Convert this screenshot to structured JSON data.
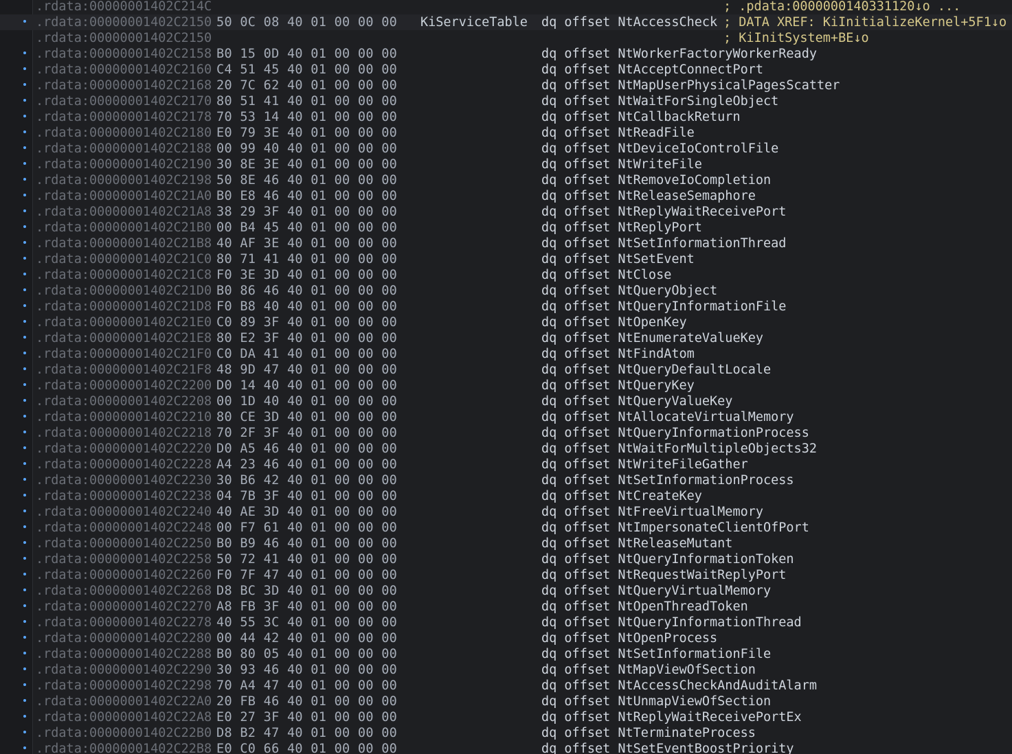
{
  "colors": {
    "background": "#1e1f22",
    "address": "#6b6f77",
    "bytes": "#a6adb8",
    "code": "#d0d6de",
    "comment": "#d7c98a",
    "breakpoint_dot": "#5aa7ff"
  },
  "rows": [
    {
      "addr": ".rdata:00000001402C214C",
      "bytes": "",
      "label": "",
      "instr": "",
      "comment": "; .pdata:0000000140331120↓o ...",
      "dot": false
    },
    {
      "addr": ".rdata:00000001402C2150",
      "bytes": "50 0C 08 40 01 00 00 00",
      "label": "KiServiceTable",
      "instr": "dq offset NtAccessCheck",
      "comment": "; DATA XREF: KiInitializeKernel+5F1↓o",
      "dot": true
    },
    {
      "addr": ".rdata:00000001402C2150",
      "bytes": "",
      "label": "",
      "instr": "",
      "comment": "; KiInitSystem+BE↓o",
      "dot": false
    },
    {
      "addr": ".rdata:00000001402C2158",
      "bytes": "B0 15 0D 40 01 00 00 00",
      "label": "",
      "instr": "dq offset NtWorkerFactoryWorkerReady",
      "comment": "",
      "dot": true
    },
    {
      "addr": ".rdata:00000001402C2160",
      "bytes": "C4 51 45 40 01 00 00 00",
      "label": "",
      "instr": "dq offset NtAcceptConnectPort",
      "comment": "",
      "dot": true
    },
    {
      "addr": ".rdata:00000001402C2168",
      "bytes": "20 7C 62 40 01 00 00 00",
      "label": "",
      "instr": "dq offset NtMapUserPhysicalPagesScatter",
      "comment": "",
      "dot": true
    },
    {
      "addr": ".rdata:00000001402C2170",
      "bytes": "80 51 41 40 01 00 00 00",
      "label": "",
      "instr": "dq offset NtWaitForSingleObject",
      "comment": "",
      "dot": true
    },
    {
      "addr": ".rdata:00000001402C2178",
      "bytes": "70 53 14 40 01 00 00 00",
      "label": "",
      "instr": "dq offset NtCallbackReturn",
      "comment": "",
      "dot": true
    },
    {
      "addr": ".rdata:00000001402C2180",
      "bytes": "E0 79 3E 40 01 00 00 00",
      "label": "",
      "instr": "dq offset NtReadFile",
      "comment": "",
      "dot": true
    },
    {
      "addr": ".rdata:00000001402C2188",
      "bytes": "00 99 40 40 01 00 00 00",
      "label": "",
      "instr": "dq offset NtDeviceIoControlFile",
      "comment": "",
      "dot": true
    },
    {
      "addr": ".rdata:00000001402C2190",
      "bytes": "30 8E 3E 40 01 00 00 00",
      "label": "",
      "instr": "dq offset NtWriteFile",
      "comment": "",
      "dot": true
    },
    {
      "addr": ".rdata:00000001402C2198",
      "bytes": "50 8E 46 40 01 00 00 00",
      "label": "",
      "instr": "dq offset NtRemoveIoCompletion",
      "comment": "",
      "dot": true
    },
    {
      "addr": ".rdata:00000001402C21A0",
      "bytes": "B0 E8 46 40 01 00 00 00",
      "label": "",
      "instr": "dq offset NtReleaseSemaphore",
      "comment": "",
      "dot": true
    },
    {
      "addr": ".rdata:00000001402C21A8",
      "bytes": "38 29 3F 40 01 00 00 00",
      "label": "",
      "instr": "dq offset NtReplyWaitReceivePort",
      "comment": "",
      "dot": true
    },
    {
      "addr": ".rdata:00000001402C21B0",
      "bytes": "00 B4 45 40 01 00 00 00",
      "label": "",
      "instr": "dq offset NtReplyPort",
      "comment": "",
      "dot": true
    },
    {
      "addr": ".rdata:00000001402C21B8",
      "bytes": "40 AF 3E 40 01 00 00 00",
      "label": "",
      "instr": "dq offset NtSetInformationThread",
      "comment": "",
      "dot": true
    },
    {
      "addr": ".rdata:00000001402C21C0",
      "bytes": "80 71 41 40 01 00 00 00",
      "label": "",
      "instr": "dq offset NtSetEvent",
      "comment": "",
      "dot": true
    },
    {
      "addr": ".rdata:00000001402C21C8",
      "bytes": "F0 3E 3D 40 01 00 00 00",
      "label": "",
      "instr": "dq offset NtClose",
      "comment": "",
      "dot": true
    },
    {
      "addr": ".rdata:00000001402C21D0",
      "bytes": "B0 86 46 40 01 00 00 00",
      "label": "",
      "instr": "dq offset NtQueryObject",
      "comment": "",
      "dot": true
    },
    {
      "addr": ".rdata:00000001402C21D8",
      "bytes": "F0 B8 40 40 01 00 00 00",
      "label": "",
      "instr": "dq offset NtQueryInformationFile",
      "comment": "",
      "dot": true
    },
    {
      "addr": ".rdata:00000001402C21E0",
      "bytes": "C0 89 3F 40 01 00 00 00",
      "label": "",
      "instr": "dq offset NtOpenKey",
      "comment": "",
      "dot": true
    },
    {
      "addr": ".rdata:00000001402C21E8",
      "bytes": "80 E2 3F 40 01 00 00 00",
      "label": "",
      "instr": "dq offset NtEnumerateValueKey",
      "comment": "",
      "dot": true
    },
    {
      "addr": ".rdata:00000001402C21F0",
      "bytes": "C0 DA 41 40 01 00 00 00",
      "label": "",
      "instr": "dq offset NtFindAtom",
      "comment": "",
      "dot": true
    },
    {
      "addr": ".rdata:00000001402C21F8",
      "bytes": "48 9D 47 40 01 00 00 00",
      "label": "",
      "instr": "dq offset NtQueryDefaultLocale",
      "comment": "",
      "dot": true
    },
    {
      "addr": ".rdata:00000001402C2200",
      "bytes": "D0 14 40 40 01 00 00 00",
      "label": "",
      "instr": "dq offset NtQueryKey",
      "comment": "",
      "dot": true
    },
    {
      "addr": ".rdata:00000001402C2208",
      "bytes": "00 1D 40 40 01 00 00 00",
      "label": "",
      "instr": "dq offset NtQueryValueKey",
      "comment": "",
      "dot": true
    },
    {
      "addr": ".rdata:00000001402C2210",
      "bytes": "80 CE 3D 40 01 00 00 00",
      "label": "",
      "instr": "dq offset NtAllocateVirtualMemory",
      "comment": "",
      "dot": true
    },
    {
      "addr": ".rdata:00000001402C2218",
      "bytes": "70 2F 3F 40 01 00 00 00",
      "label": "",
      "instr": "dq offset NtQueryInformationProcess",
      "comment": "",
      "dot": true
    },
    {
      "addr": ".rdata:00000001402C2220",
      "bytes": "D0 A5 46 40 01 00 00 00",
      "label": "",
      "instr": "dq offset NtWaitForMultipleObjects32",
      "comment": "",
      "dot": true
    },
    {
      "addr": ".rdata:00000001402C2228",
      "bytes": "A4 23 46 40 01 00 00 00",
      "label": "",
      "instr": "dq offset NtWriteFileGather",
      "comment": "",
      "dot": true
    },
    {
      "addr": ".rdata:00000001402C2230",
      "bytes": "30 B6 42 40 01 00 00 00",
      "label": "",
      "instr": "dq offset NtSetInformationProcess",
      "comment": "",
      "dot": true
    },
    {
      "addr": ".rdata:00000001402C2238",
      "bytes": "04 7B 3F 40 01 00 00 00",
      "label": "",
      "instr": "dq offset NtCreateKey",
      "comment": "",
      "dot": true
    },
    {
      "addr": ".rdata:00000001402C2240",
      "bytes": "40 AE 3D 40 01 00 00 00",
      "label": "",
      "instr": "dq offset NtFreeVirtualMemory",
      "comment": "",
      "dot": true
    },
    {
      "addr": ".rdata:00000001402C2248",
      "bytes": "00 F7 61 40 01 00 00 00",
      "label": "",
      "instr": "dq offset NtImpersonateClientOfPort",
      "comment": "",
      "dot": true
    },
    {
      "addr": ".rdata:00000001402C2250",
      "bytes": "B0 B9 46 40 01 00 00 00",
      "label": "",
      "instr": "dq offset NtReleaseMutant",
      "comment": "",
      "dot": true
    },
    {
      "addr": ".rdata:00000001402C2258",
      "bytes": "50 72 41 40 01 00 00 00",
      "label": "",
      "instr": "dq offset NtQueryInformationToken",
      "comment": "",
      "dot": true
    },
    {
      "addr": ".rdata:00000001402C2260",
      "bytes": "F0 7F 47 40 01 00 00 00",
      "label": "",
      "instr": "dq offset NtRequestWaitReplyPort",
      "comment": "",
      "dot": true
    },
    {
      "addr": ".rdata:00000001402C2268",
      "bytes": "D8 BC 3D 40 01 00 00 00",
      "label": "",
      "instr": "dq offset NtQueryVirtualMemory",
      "comment": "",
      "dot": true
    },
    {
      "addr": ".rdata:00000001402C2270",
      "bytes": "A8 FB 3F 40 01 00 00 00",
      "label": "",
      "instr": "dq offset NtOpenThreadToken",
      "comment": "",
      "dot": true
    },
    {
      "addr": ".rdata:00000001402C2278",
      "bytes": "40 55 3C 40 01 00 00 00",
      "label": "",
      "instr": "dq offset NtQueryInformationThread",
      "comment": "",
      "dot": true
    },
    {
      "addr": ".rdata:00000001402C2280",
      "bytes": "00 44 42 40 01 00 00 00",
      "label": "",
      "instr": "dq offset NtOpenProcess",
      "comment": "",
      "dot": true
    },
    {
      "addr": ".rdata:00000001402C2288",
      "bytes": "B0 80 05 40 01 00 00 00",
      "label": "",
      "instr": "dq offset NtSetInformationFile",
      "comment": "",
      "dot": true
    },
    {
      "addr": ".rdata:00000001402C2290",
      "bytes": "30 93 46 40 01 00 00 00",
      "label": "",
      "instr": "dq offset NtMapViewOfSection",
      "comment": "",
      "dot": true
    },
    {
      "addr": ".rdata:00000001402C2298",
      "bytes": "70 A4 47 40 01 00 00 00",
      "label": "",
      "instr": "dq offset NtAccessCheckAndAuditAlarm",
      "comment": "",
      "dot": true
    },
    {
      "addr": ".rdata:00000001402C22A0",
      "bytes": "20 FB 46 40 01 00 00 00",
      "label": "",
      "instr": "dq offset NtUnmapViewOfSection",
      "comment": "",
      "dot": true
    },
    {
      "addr": ".rdata:00000001402C22A8",
      "bytes": "E0 27 3F 40 01 00 00 00",
      "label": "",
      "instr": "dq offset NtReplyWaitReceivePortEx",
      "comment": "",
      "dot": true
    },
    {
      "addr": ".rdata:00000001402C22B0",
      "bytes": "D8 B2 47 40 01 00 00 00",
      "label": "",
      "instr": "dq offset NtTerminateProcess",
      "comment": "",
      "dot": true
    },
    {
      "addr": ".rdata:00000001402C22B8",
      "bytes": "E0 C0 66 40 01 00 00 00",
      "label": "",
      "instr": "dq offset NtSetEventBoostPriority",
      "comment": "",
      "dot": true
    }
  ]
}
